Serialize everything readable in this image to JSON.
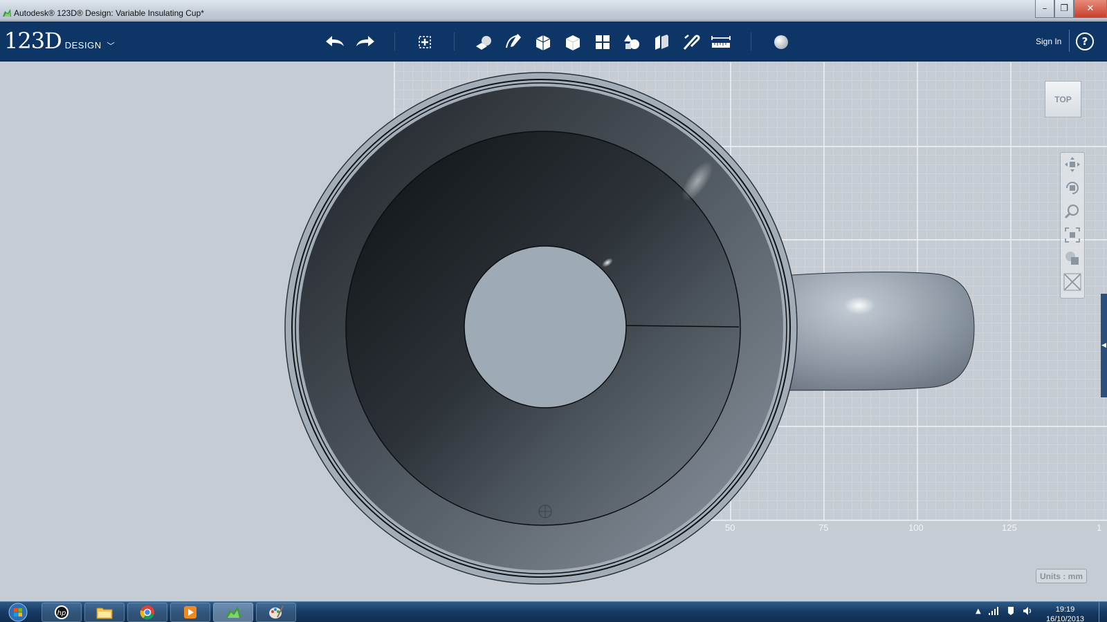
{
  "window": {
    "title": "Autodesk® 123D® Design: Variable Insulating Cup*",
    "controls": [
      "minimize",
      "restore",
      "close"
    ]
  },
  "toolbar": {
    "logo_main": "123D",
    "logo_sub": "DESIGN",
    "icons": [
      "undo-icon",
      "redo-icon",
      "transform-icon",
      "primitives-icon",
      "sketch-icon",
      "construct-icon",
      "modify-icon",
      "pattern-icon",
      "grouping-icon",
      "combine-icon",
      "snap-icon",
      "measure-icon",
      "material-icon"
    ],
    "sign_in": "Sign In",
    "help": "?"
  },
  "viewport": {
    "view_cube_label": "TOP",
    "axis_ticks": [
      "50",
      "75",
      "100",
      "125",
      "1"
    ],
    "units_label": "Units : mm",
    "nav_tools": [
      "pan-icon",
      "orbit-icon",
      "zoom-icon",
      "fit-icon",
      "view-mode-icon",
      "material-toggle-icon"
    ]
  },
  "taskbar": {
    "apps": [
      "hp",
      "explorer",
      "chrome",
      "media-player",
      "123d-design",
      "paint"
    ],
    "time": "19:19",
    "date": "16/10/2013"
  }
}
